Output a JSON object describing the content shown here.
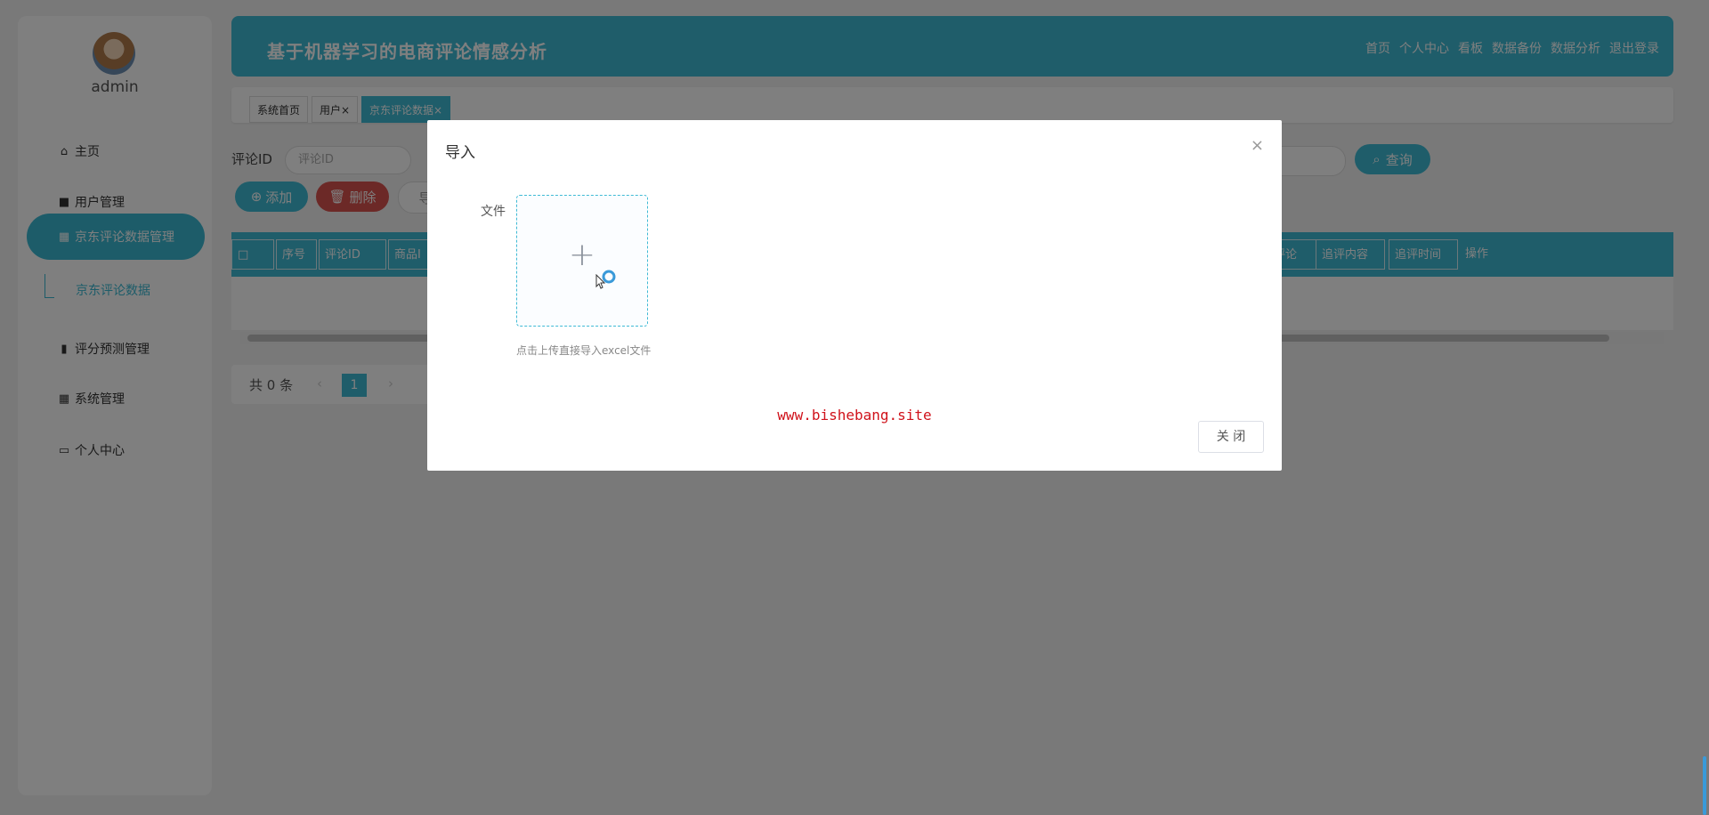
{
  "sidebar": {
    "username": "admin",
    "items": [
      {
        "label": "主页",
        "icon": "home-icon"
      },
      {
        "label": "用户管理",
        "icon": "briefcase-icon"
      },
      {
        "label": "京东评论数据管理",
        "icon": "grid-icon"
      },
      {
        "label": "评分预测管理",
        "icon": "clipboard-icon"
      },
      {
        "label": "系统管理",
        "icon": "grid-icon"
      },
      {
        "label": "个人中心",
        "icon": "card-icon"
      }
    ],
    "subitem": "京东评论数据"
  },
  "header": {
    "title": "基于机器学习的电商评论情感分析",
    "nav": [
      "首页",
      "个人中心",
      "看板",
      "数据备份",
      "数据分析",
      "退出登录"
    ]
  },
  "tabs": [
    {
      "label": "系统首页"
    },
    {
      "label": "用户×"
    },
    {
      "label": "京东评论数据×"
    }
  ],
  "search": {
    "label": "评论ID",
    "placeholder": "评论ID",
    "query_label": "查询"
  },
  "toolbar": {
    "add_label": "添加",
    "delete_label": "删除",
    "import_label": "导"
  },
  "table": {
    "columns": [
      "序号",
      "评论ID",
      "商品I",
      "评论",
      "追评内容",
      "追评时间",
      "操作"
    ]
  },
  "pager": {
    "total": "共 0 条",
    "current_page": "1"
  },
  "modal": {
    "title": "导入",
    "file_label": "文件",
    "upload_hint": "点击上传直接导入excel文件",
    "watermark": "www.bishebang.site",
    "close_label": "关 闭"
  },
  "colors": {
    "accent": "#3fbad5",
    "danger": "#d9534f",
    "watermark": "#d0121b"
  }
}
